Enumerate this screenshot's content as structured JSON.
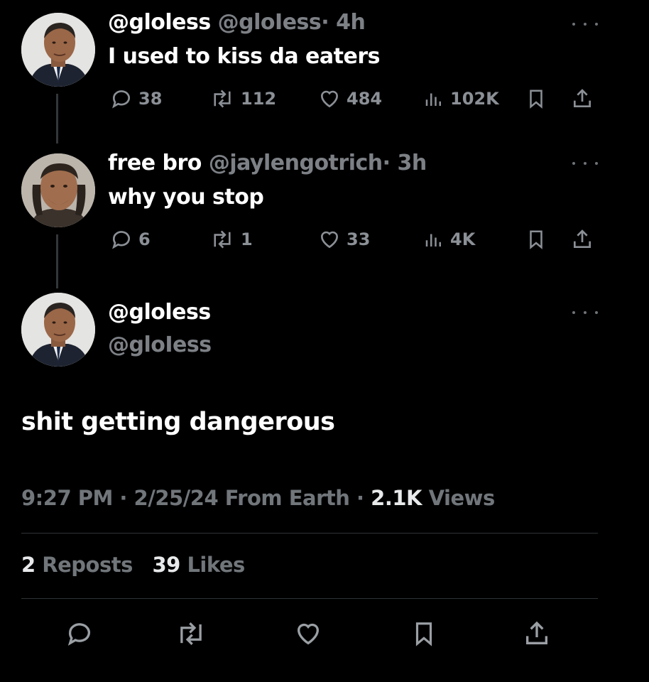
{
  "tweets": [
    {
      "display_name": "@gloless",
      "handle": "@gloIess",
      "time": "· 4h",
      "text": "I used to kiss da eaters",
      "replies": "38",
      "reposts": "112",
      "likes": "484",
      "views": "102K"
    },
    {
      "display_name": "free bro",
      "handle": "@jaylengotrich",
      "time": "· 3h",
      "text": "why you stop",
      "replies": "6",
      "reposts": "1",
      "likes": "33",
      "views": "4K"
    }
  ],
  "main_tweet": {
    "display_name": "@gloless",
    "handle": "@gloIess",
    "text": "shit getting dangerous",
    "time": "9:27 PM · 2/25/24 From Earth ·",
    "views_count": "2.1K",
    "views_label": "Views",
    "reposts_count": "2",
    "reposts_label": "Reposts",
    "likes_count": "39",
    "likes_label": "Likes"
  },
  "icons": {
    "reply": "reply-icon",
    "repost": "repost-icon",
    "like": "heart-icon",
    "views": "views-icon",
    "bookmark": "bookmark-icon",
    "share": "share-icon",
    "more": "more-icon"
  },
  "colors": {
    "background": "#000000",
    "text": "#e7e9ea",
    "muted": "#71767b",
    "divider": "#2f3336"
  }
}
